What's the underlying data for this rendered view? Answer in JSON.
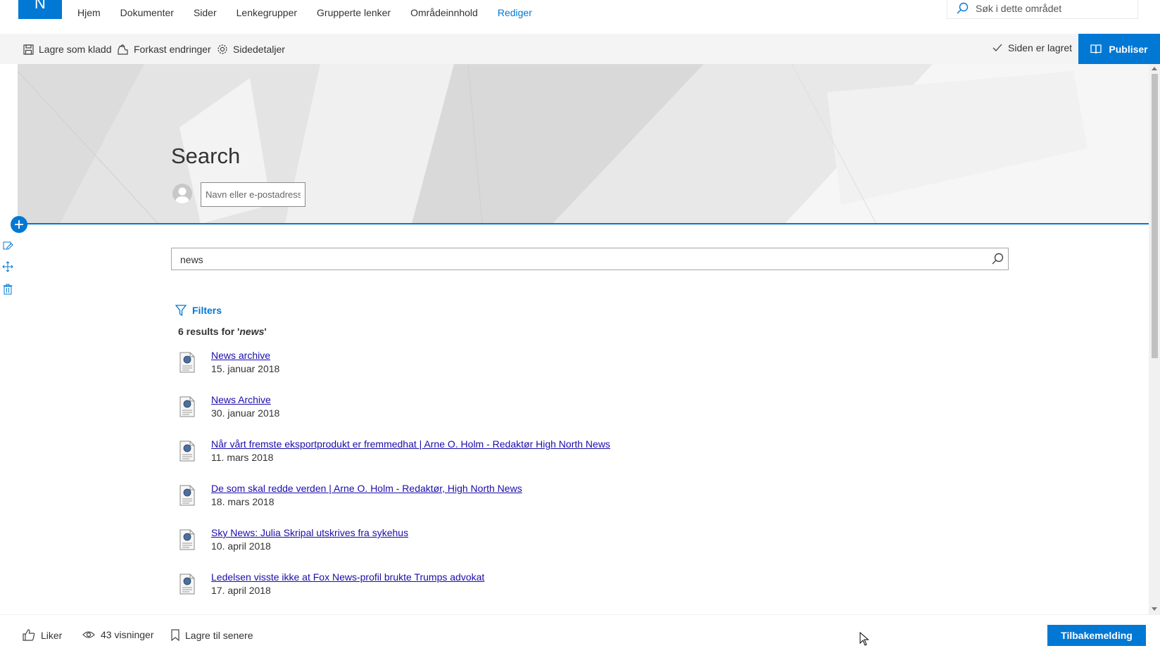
{
  "site": {
    "logo_letter": "N",
    "nav": [
      {
        "label": "Hjem",
        "active": false
      },
      {
        "label": "Dokumenter",
        "active": false
      },
      {
        "label": "Sider",
        "active": false
      },
      {
        "label": "Lenkegrupper",
        "active": false
      },
      {
        "label": "Grupperte lenker",
        "active": false
      },
      {
        "label": "Områdeinnhold",
        "active": false
      },
      {
        "label": "Rediger",
        "active": true
      }
    ],
    "search_placeholder": "Søk i dette området"
  },
  "commandbar": {
    "save_draft": "Lagre som kladd",
    "discard": "Forkast endringer",
    "page_details": "Sidedetaljer",
    "saved_status": "Siden er lagret",
    "publish": "Publiser"
  },
  "hero": {
    "title": "Search",
    "author_placeholder": "Navn eller e-postadresse"
  },
  "search": {
    "query": "news",
    "filters_label": "Filters",
    "count_prefix": "6 results for '",
    "count_query": "news",
    "count_suffix": "'",
    "results": [
      {
        "title": "News archive",
        "date": "15. januar 2018"
      },
      {
        "title": "News Archive",
        "date": "30. januar 2018"
      },
      {
        "title": "Når vårt fremste eksportprodukt er fremmedhat | Arne O. Holm - Redaktør High North News",
        "date": "11. mars 2018"
      },
      {
        "title": "De som skal redde verden | Arne O. Holm - Redaktør, High North News",
        "date": "18. mars 2018"
      },
      {
        "title": "Sky News: Julia Skripal utskrives fra sykehus",
        "date": "10. april 2018"
      },
      {
        "title": "Ledelsen visste ikke at Fox News-profil brukte Trumps advokat",
        "date": "17. april 2018"
      }
    ]
  },
  "footer": {
    "like": "Liker",
    "views": "43 visninger",
    "save_later": "Lagre til senere",
    "feedback": "Tilbakemelding"
  },
  "colors": {
    "accent": "#0078d4",
    "link": "#1a0dab"
  }
}
